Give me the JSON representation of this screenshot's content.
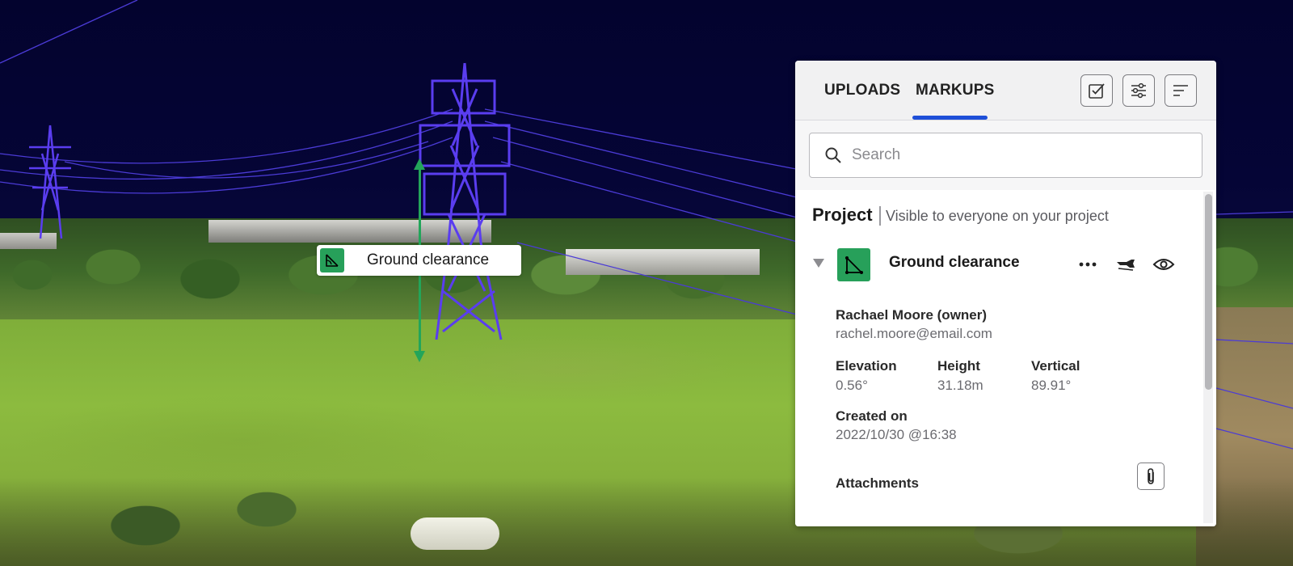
{
  "scene": {
    "label_text": "Ground clearance"
  },
  "panel": {
    "tabs": [
      {
        "label": "UPLOADS",
        "active": false
      },
      {
        "label": "MARKUPS",
        "active": true
      }
    ],
    "header_buttons": [
      "checkbox-icon",
      "sliders-icon",
      "sort-lines-icon"
    ],
    "search": {
      "placeholder": "Search",
      "value": ""
    },
    "section": {
      "title": "Project",
      "subtitle": "Visible to everyone on your project"
    },
    "markup": {
      "title": "Ground clearance",
      "icon": "angle-measure-icon",
      "expanded": true,
      "actions": [
        "more-icon",
        "fly-to-icon",
        "eye-icon"
      ],
      "owner_name": "Rachael Moore (owner)",
      "owner_email": "rachel.moore@email.com",
      "measurements": [
        {
          "label": "Elevation",
          "value": "0.56°"
        },
        {
          "label": "Height",
          "value": "31.18m"
        },
        {
          "label": "Vertical",
          "value": "89.91°"
        }
      ],
      "created_label": "Created on",
      "created_value": "2022/10/30 @16:38",
      "attachments_label": "Attachments"
    },
    "colors": {
      "accent_tab": "#1e4fd8",
      "markup_green": "#27a05a"
    }
  }
}
